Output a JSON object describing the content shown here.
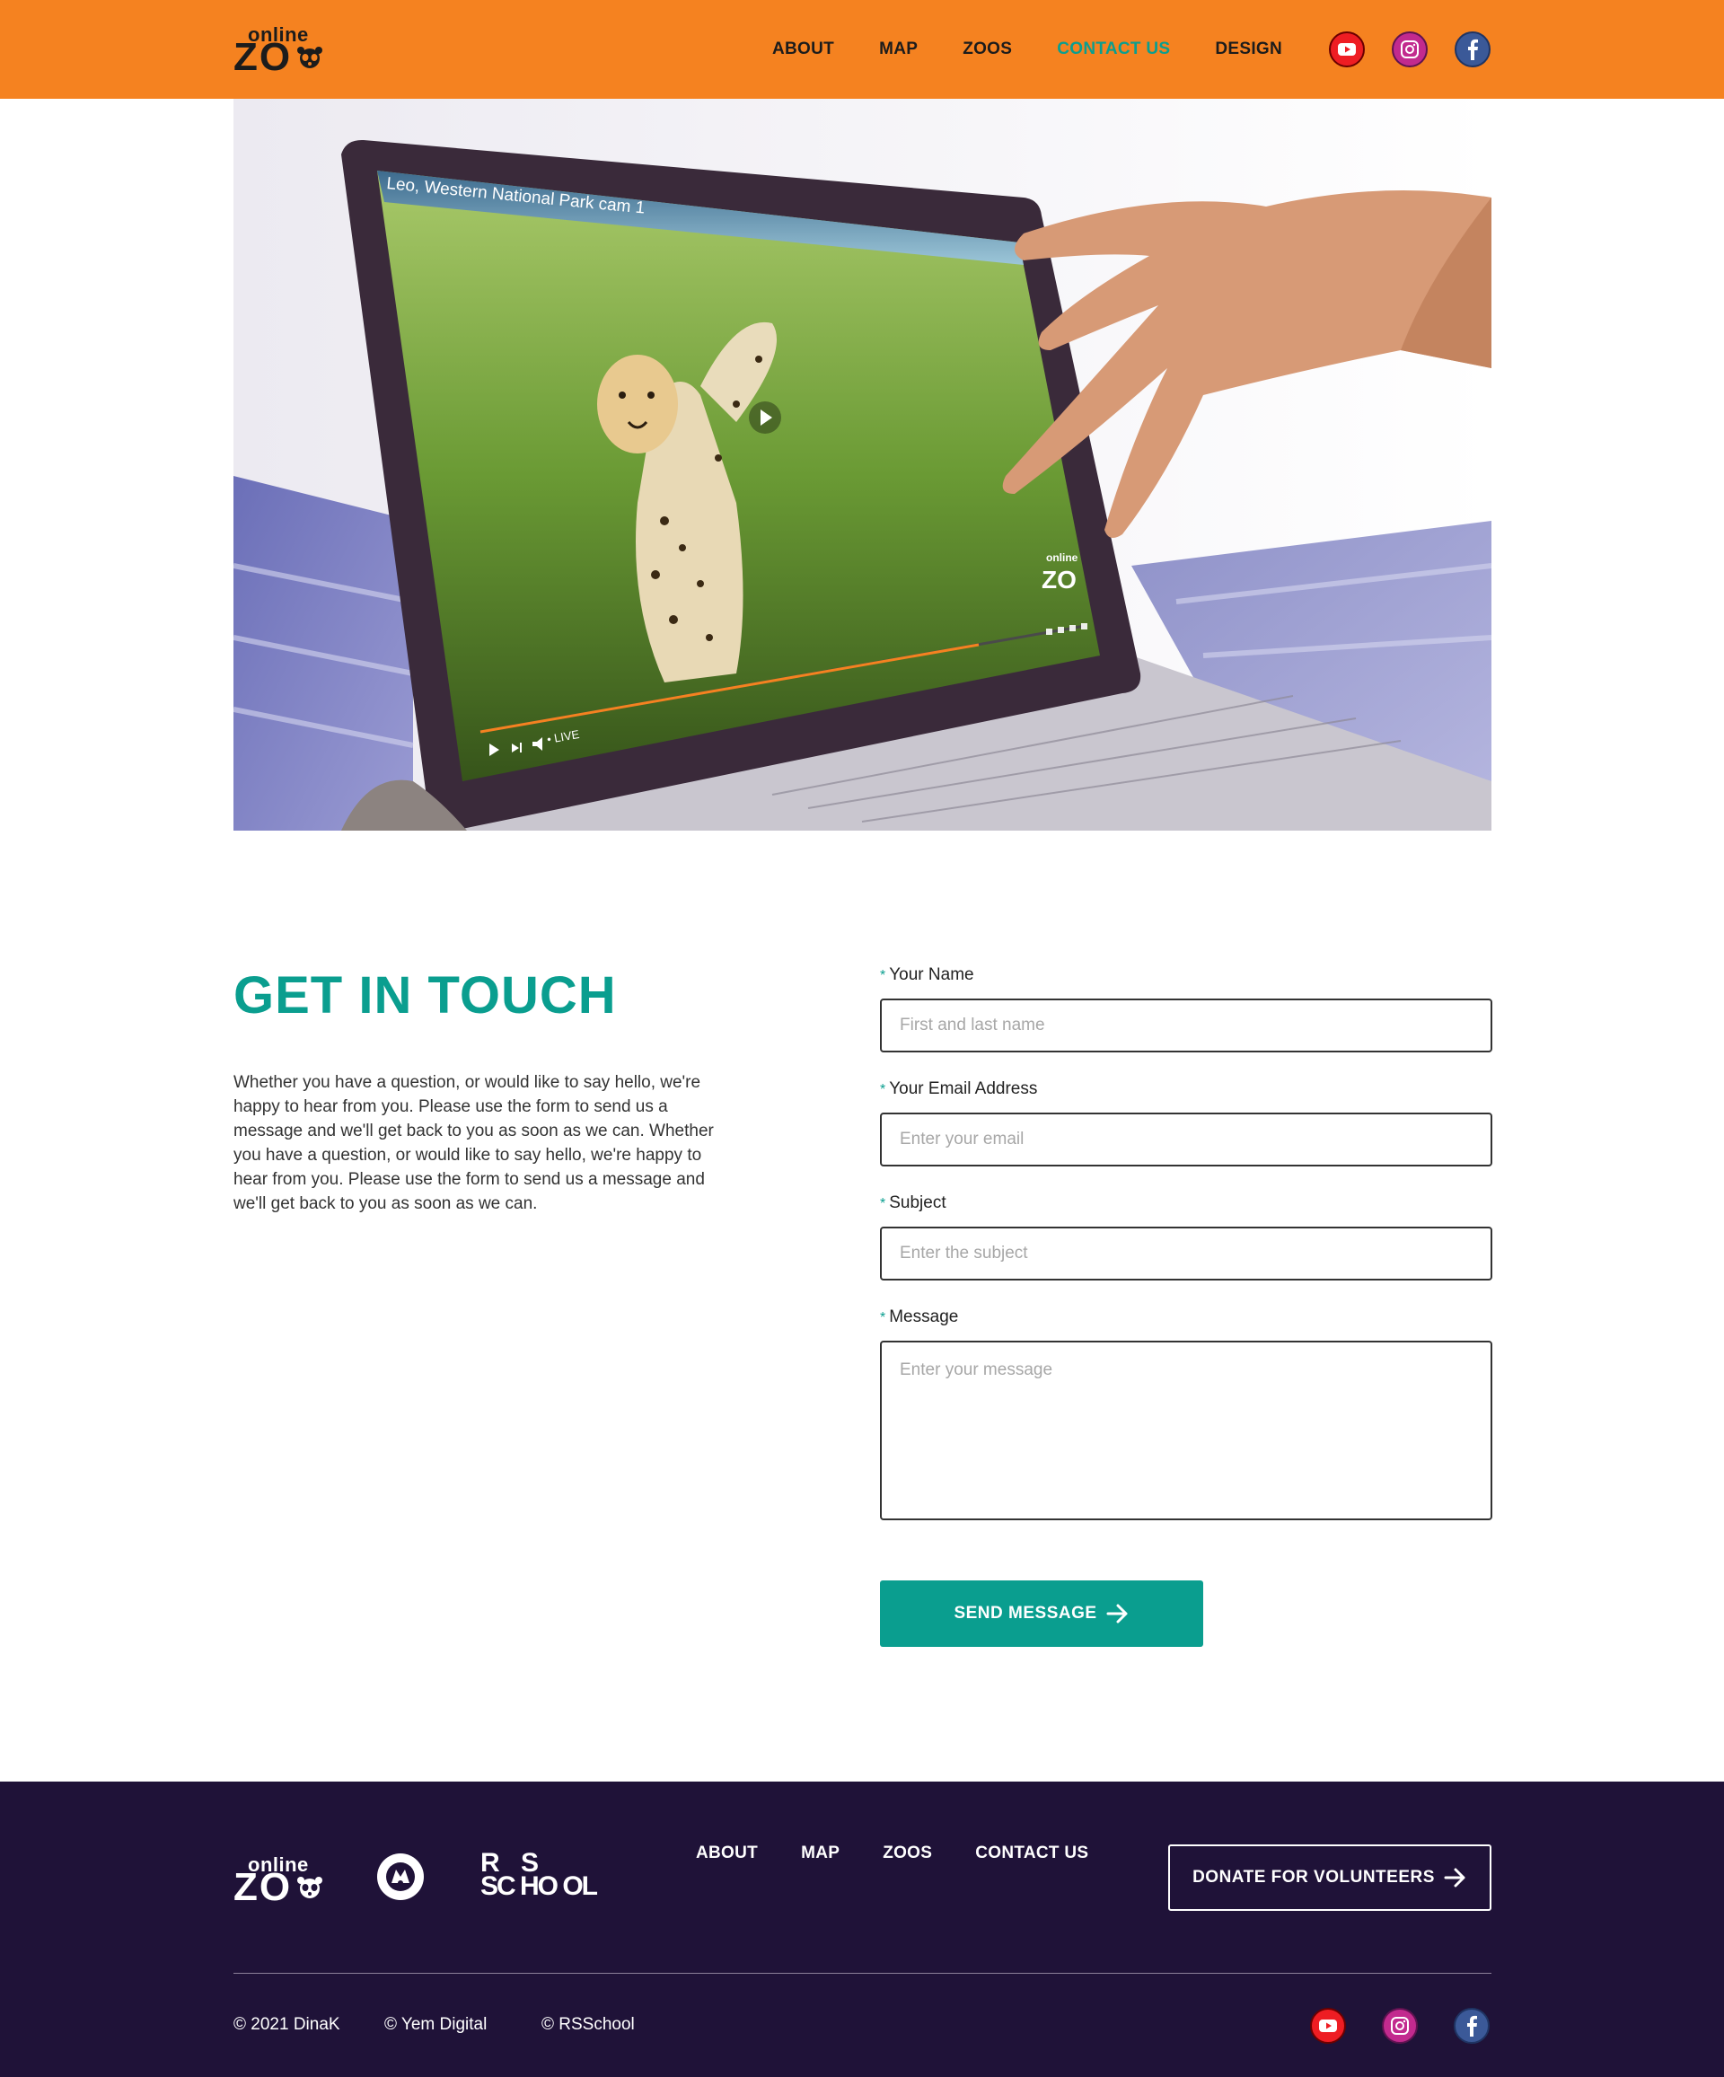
{
  "brand": {
    "logo_small": "online",
    "logo_big": "ZO"
  },
  "header": {
    "nav": [
      {
        "label": "ABOUT"
      },
      {
        "label": "MAP"
      },
      {
        "label": "ZOOS"
      },
      {
        "label": "CONTACT US",
        "active": true
      },
      {
        "label": "DESIGN"
      }
    ],
    "social": [
      "youtube-icon",
      "instagram-icon",
      "facebook-icon"
    ]
  },
  "hero": {
    "video_title": "Leo, Western National Park cam 1",
    "live_label": "• LIVE",
    "overlay_logo_small": "online",
    "overlay_logo_big": "ZO"
  },
  "contact": {
    "title": "GET IN TOUCH",
    "description": "Whether you have a question, or would like to say hello, we're happy to hear from you. Please use the form to send us a message and we'll get back to you as soon as we can. Whether you have a question, or would like to say hello, we're happy to hear from you. Please use the form to send us a message and we'll get back to you as soon as we can.",
    "required_marker": "*",
    "fields": {
      "name": {
        "label": "Your Name",
        "placeholder": "First and last name",
        "value": ""
      },
      "email": {
        "label": "Your Email Address",
        "placeholder": "Enter your email",
        "value": ""
      },
      "subject": {
        "label": "Subject",
        "placeholder": "Enter the subject",
        "value": ""
      },
      "message": {
        "label": "Message",
        "placeholder": "Enter your message",
        "value": ""
      }
    },
    "submit_label": "SEND MESSAGE"
  },
  "footer": {
    "logo_small": "online",
    "logo_big": "ZO",
    "rss_line1": "R    S",
    "rss_line2": "SC HO OL",
    "nav": [
      {
        "label": "ABOUT"
      },
      {
        "label": "MAP"
      },
      {
        "label": "ZOOS"
      },
      {
        "label": "CONTACT US"
      }
    ],
    "donate_label": "DONATE FOR VOLUNTEERS",
    "copyrights": [
      "© 2021 DinaK",
      "© Yem Digital",
      "© RSSchool"
    ]
  },
  "colors": {
    "header_bg": "#f58220",
    "accent": "#0a9e8f",
    "footer_bg": "#1f1238",
    "text": "#222222"
  }
}
